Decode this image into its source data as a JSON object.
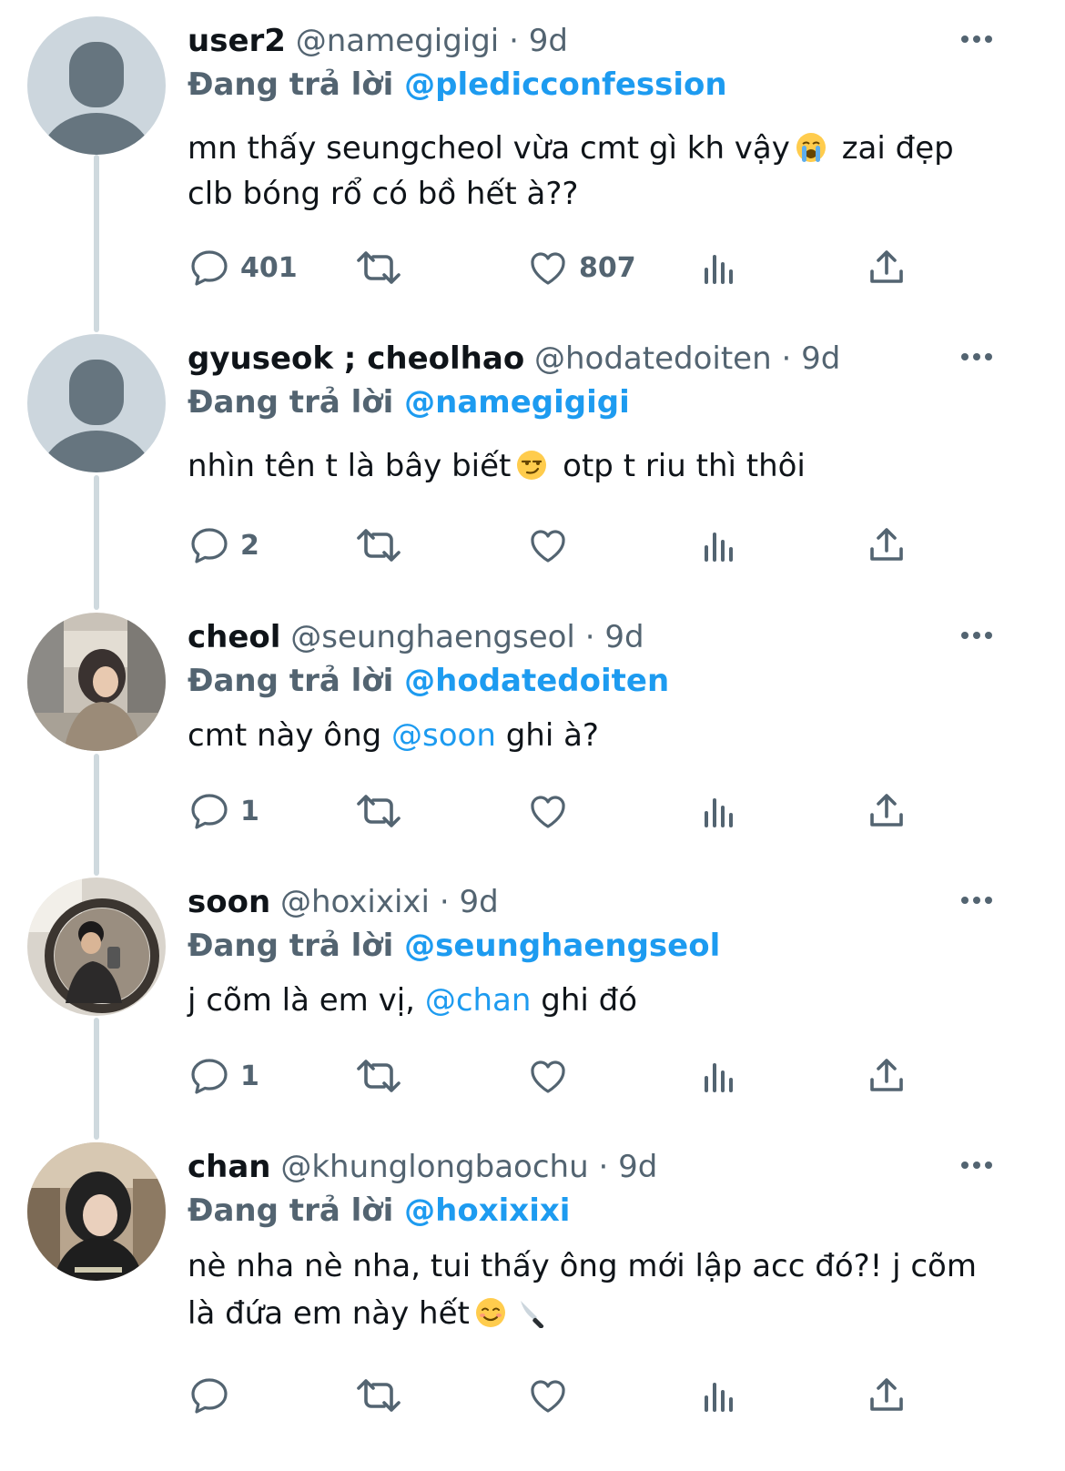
{
  "labels": {
    "replying": "Đang trả lời"
  },
  "colors": {
    "accent": "#1d9bf0",
    "secondary_text": "#536471",
    "primary_text": "#0f1419",
    "thread_line": "#cfd9de"
  },
  "tweets": [
    {
      "name": "user2",
      "handle": "@namegigigi",
      "dot": "·",
      "time": "9d",
      "reply_to": "@pledicconfession",
      "avatar": "default-avatar",
      "text_parts": [
        "mn thấy seungcheol vừa cmt gì kh vậy",
        "zai đẹp clb bóng rổ có bồ hết à??"
      ],
      "emoji": "loudly-crying-face",
      "replies": "401",
      "likes": "807"
    },
    {
      "name": "gyuseok ; cheolhao",
      "handle": "@hodatedoiten",
      "dot": "·",
      "time": "9d",
      "reply_to": "@namegigigi",
      "avatar": "default-avatar",
      "text_parts": [
        "nhìn tên t là bây biết",
        "otp t riu thì thôi"
      ],
      "emoji": "smirking-face",
      "replies": "2",
      "likes": ""
    },
    {
      "name": "cheol",
      "handle": "@seunghaengseol",
      "dot": "·",
      "time": "9d",
      "reply_to": "@hodatedoiten",
      "avatar": "photo-avatar-hoodie-street",
      "text_parts": [
        "cmt này ông",
        "@soon",
        "ghi à?"
      ],
      "replies": "1",
      "likes": ""
    },
    {
      "name": "soon",
      "handle": "@hoxixixi",
      "dot": "·",
      "time": "9d",
      "reply_to": "@seunghaengseol",
      "avatar": "photo-avatar-mirror-selfie",
      "text_parts": [
        "j cõm là em vị,",
        "@chan",
        "ghi đó"
      ],
      "replies": "1",
      "likes": ""
    },
    {
      "name": "chan",
      "handle": "@khunglongbaochu",
      "dot": "·",
      "time": "9d",
      "reply_to": "@hoxixixi",
      "avatar": "photo-avatar-hood-cafe",
      "text_parts": [
        "nè nha nè nha, tui thấy ông mới lập acc đó?! j cõm",
        "là đứa em này hết"
      ],
      "emoji_end": [
        "smiling-face",
        "kitchen-knife"
      ],
      "replies": "",
      "likes": ""
    }
  ]
}
